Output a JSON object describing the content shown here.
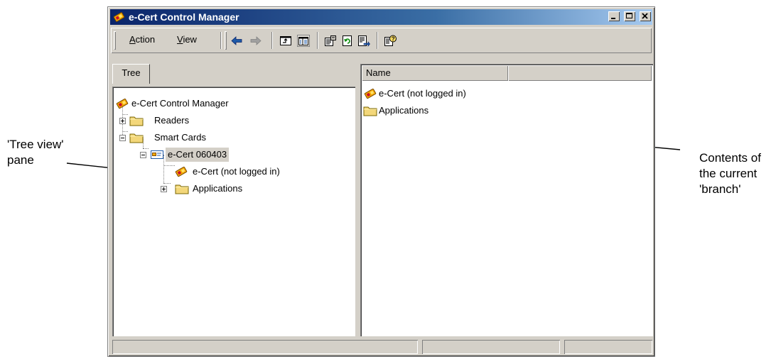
{
  "window": {
    "title": "e-Cert Control Manager"
  },
  "toolbar": {
    "menu_action": "Action",
    "menu_view": "View",
    "icons": [
      "back-arrow-icon",
      "forward-arrow-icon",
      "up-one-level-icon",
      "show-hide-tree-icon",
      "properties-icon",
      "refresh-icon",
      "export-list-icon",
      "help-icon"
    ]
  },
  "left_pane": {
    "tab_label": "Tree",
    "tree": [
      {
        "label": "e-Cert Control Manager",
        "icon": "ecert-icon"
      },
      {
        "label": "Readers",
        "icon": "folder-icon",
        "expander": "+"
      },
      {
        "label": "Smart Cards",
        "icon": "folder-icon",
        "expander": "-"
      },
      {
        "label": "e-Cert 060403",
        "icon": "smart-card-icon",
        "expander": "-",
        "selected": true
      },
      {
        "label": "e-Cert (not logged in)",
        "icon": "ecert-icon"
      },
      {
        "label": "Applications",
        "icon": "folder-icon",
        "expander": "+"
      }
    ]
  },
  "right_pane": {
    "column_header": "Name",
    "items": [
      {
        "label": "e-Cert (not logged in)",
        "icon": "ecert-icon"
      },
      {
        "label": "Applications",
        "icon": "folder-icon"
      }
    ]
  },
  "annotations": {
    "left_line1": "'Tree view'",
    "left_line2": "pane",
    "right_line1": "Contents of",
    "right_line2": "the current",
    "right_line3": "'branch'"
  },
  "colors": {
    "titlebar_start": "#0a246a",
    "titlebar_end": "#a6caf0",
    "face": "#d4d0c8",
    "selected_bg": "#d4d0c8",
    "folder": "#f3d77a"
  }
}
